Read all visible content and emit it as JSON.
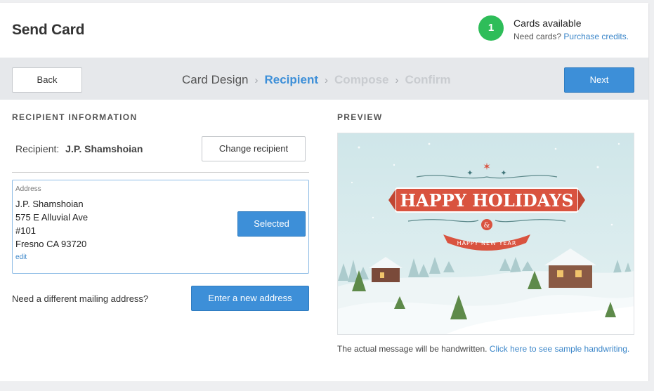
{
  "header": {
    "title": "Send Card",
    "credits_count": "1",
    "credits_title": "Cards available",
    "credits_prompt": "Need cards?",
    "credits_link": "Purchase credits."
  },
  "stepbar": {
    "back_label": "Back",
    "next_label": "Next",
    "steps": [
      "Card Design",
      "Recipient",
      "Compose",
      "Confirm"
    ],
    "active_step": "Recipient"
  },
  "recipient": {
    "section_title": "RECIPIENT INFORMATION",
    "label": "Recipient:",
    "name": "J.P. Shamshoian",
    "change_label": "Change recipient",
    "address_label": "Address",
    "address_lines": [
      "J.P. Shamshoian",
      "575 E Alluvial Ave",
      "#101",
      "Fresno CA 93720"
    ],
    "edit_label": "edit",
    "selected_label": "Selected",
    "different_prompt": "Need a different mailing address?",
    "new_address_label": "Enter a new address"
  },
  "preview": {
    "section_title": "PREVIEW",
    "card_heading": "HAPPY HOLIDAYS",
    "card_ampersand": "&",
    "card_ribbon": "HAPPY NEW YEAR",
    "note_text": "The actual message will be handwritten.",
    "note_link": "Click here to see sample handwriting."
  },
  "colors": {
    "accent": "#3d8fd8",
    "badge": "#2ebd59",
    "card_red": "#d9533f",
    "card_teal": "#3f7478"
  }
}
